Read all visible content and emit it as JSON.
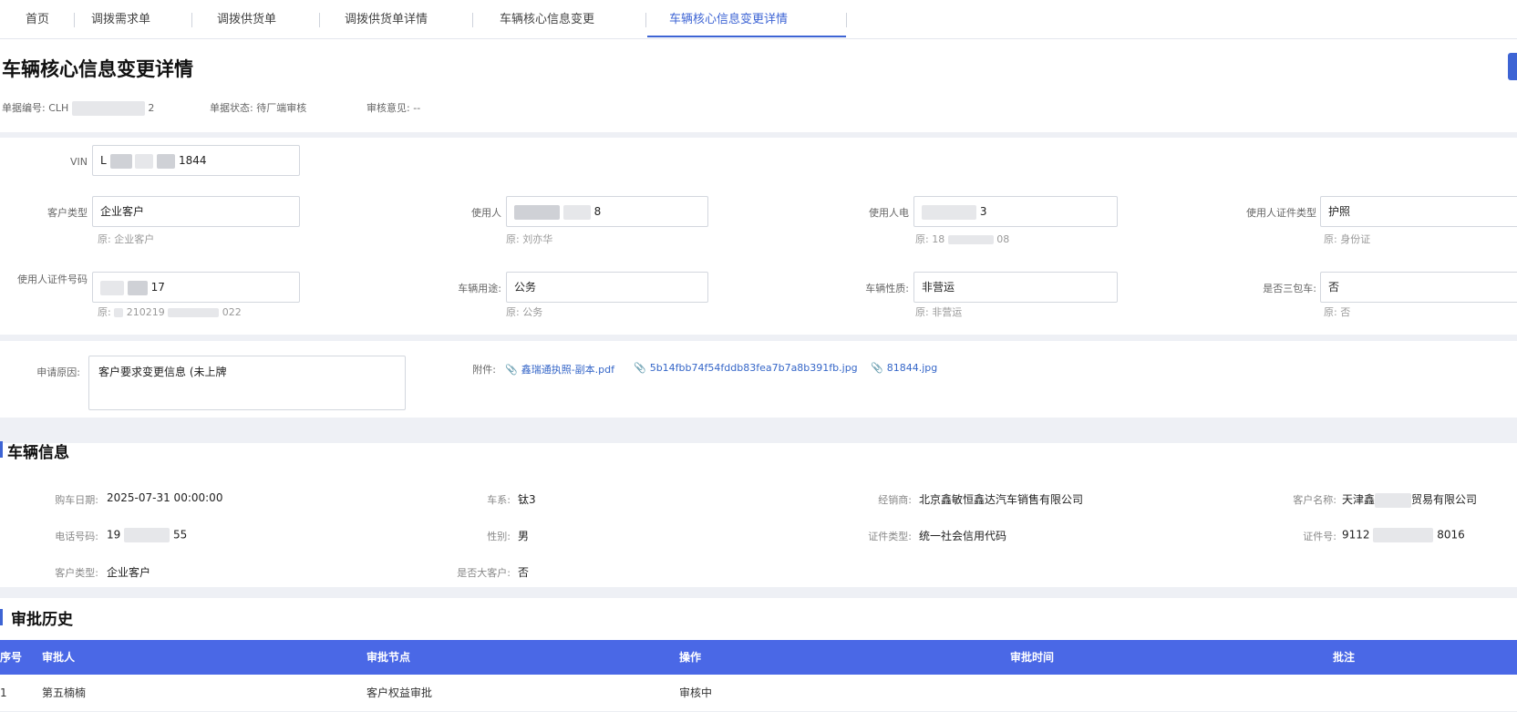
{
  "tabs": [
    {
      "label": "首页"
    },
    {
      "label": "调拨需求单"
    },
    {
      "label": "调拨供货单"
    },
    {
      "label": "调拨供货单详情"
    },
    {
      "label": "车辆核心信息变更"
    },
    {
      "label": "车辆核心信息变更详情"
    }
  ],
  "page": {
    "title": "车辆核心信息变更详情",
    "bill_no_label": "单据编号:",
    "bill_no_prefix": "CLH",
    "bill_no_suffix": "2",
    "status_label": "单据状态:",
    "status_value": "待厂端审核",
    "opinion_label": "审核意见:",
    "opinion_value": "--"
  },
  "form": {
    "vin": {
      "label": "VIN",
      "prefix": "L",
      "suffix": "1844"
    },
    "customer_type": {
      "label": "客户类型",
      "value": "企业客户",
      "orig": "原: 企业客户"
    },
    "user_name": {
      "label": "使用人",
      "suffix": "8",
      "orig": "原: 刘亦华"
    },
    "user_phone": {
      "label": "使用人电",
      "suffix": "3",
      "orig_prefix": "原: 18",
      "orig_suffix": "08"
    },
    "user_id_type": {
      "label": "使用人证件类型",
      "value": "护照",
      "orig": "原: 身份证"
    },
    "user_id_no": {
      "label": "使用人证件号码",
      "suffix": "17",
      "orig_prefix": "原:",
      "orig_mid": "210219",
      "orig_suffix": "022"
    },
    "vehicle_use": {
      "label": "车辆用途:",
      "value": "公务",
      "orig": "原: 公务"
    },
    "vehicle_nature": {
      "label": "车辆性质:",
      "value": "非营运",
      "orig": "原: 非营运"
    },
    "three_guarantee": {
      "label": "是否三包车:",
      "value": "否",
      "orig": "原: 否"
    },
    "reason": {
      "label": "申请原因:",
      "value": "客户要求变更信息 (未上牌"
    },
    "attachments_label": "附件:",
    "attachments": [
      {
        "name": "鑫瑞通执照-副本.pdf"
      },
      {
        "name": "5b14fbb74f54fddb83fea7b7a8b391fb.jpg"
      },
      {
        "name": "81844.jpg"
      }
    ]
  },
  "vehicle_info": {
    "title": "车辆信息",
    "purchase_date": {
      "label": "购车日期:",
      "value": "2025-07-31 00:00:00"
    },
    "series": {
      "label": "车系:",
      "value": "钛3"
    },
    "dealer": {
      "label": "经销商:",
      "value": "北京鑫敏恒鑫达汽车销售有限公司"
    },
    "customer_name": {
      "label": "客户名称:",
      "prefix": "天津鑫",
      "suffix": "贸易有限公司"
    },
    "phone": {
      "label": "电话号码:",
      "prefix": "19",
      "suffix": "55"
    },
    "gender": {
      "label": "性别:",
      "value": "男"
    },
    "id_type": {
      "label": "证件类型:",
      "value": "统一社会信用代码"
    },
    "id_no": {
      "label": "证件号:",
      "prefix": "9112",
      "suffix": "8016"
    },
    "customer_type": {
      "label": "客户类型:",
      "value": "企业客户"
    },
    "big_customer": {
      "label": "是否大客户:",
      "value": "否"
    }
  },
  "approval": {
    "title": "审批历史",
    "columns": [
      "序号",
      "审批人",
      "审批节点",
      "操作",
      "审批时间",
      "批注"
    ],
    "rows": [
      {
        "no": "1",
        "approver": "第五楠楠",
        "node": "客户权益审批",
        "action": "审核中",
        "time": "",
        "remark": ""
      }
    ]
  },
  "colors": {
    "accent": "#3d64d4",
    "table_header": "#4a68e6",
    "link": "#3566c8"
  }
}
